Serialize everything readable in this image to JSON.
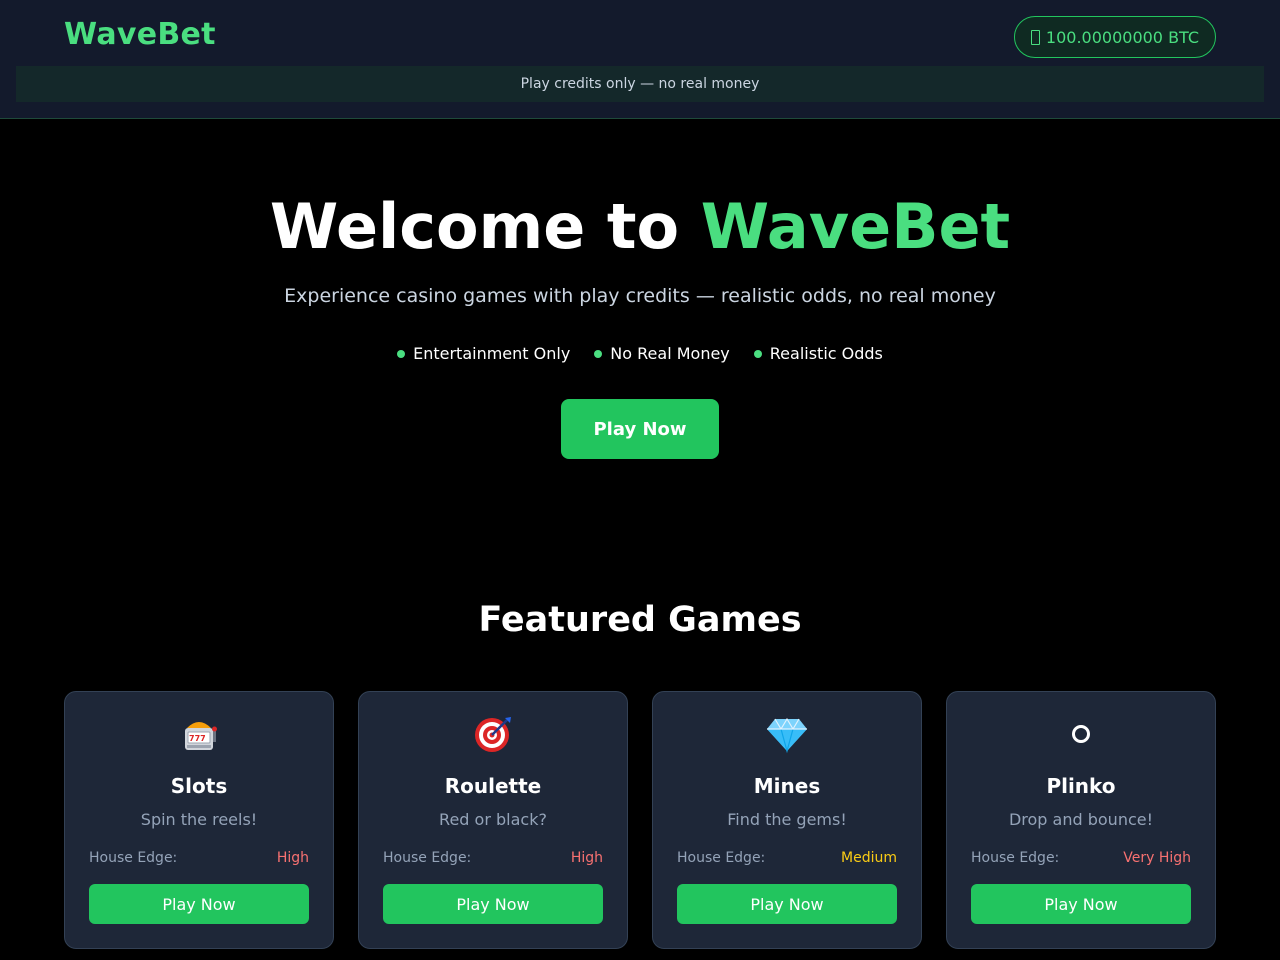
{
  "header": {
    "logo": "WaveBet",
    "balance": "100.00000000 BTC",
    "notice": "Play credits only — no real money"
  },
  "hero": {
    "title_prefix": "Welcome to",
    "title_accent": "WaveBet",
    "subtitle": "Experience casino games with play credits — realistic odds, no real money",
    "features": [
      "Entertainment Only",
      "No Real Money",
      "Realistic Odds"
    ],
    "cta_label": "Play Now"
  },
  "featured": {
    "title": "Featured Games",
    "games": [
      {
        "name": "Slots",
        "description": "Spin the reels!",
        "edge_label": "House Edge:",
        "edge_value": "High",
        "edge_color": "#f87171",
        "icon": "slot-machine-icon",
        "button": "Play Now"
      },
      {
        "name": "Roulette",
        "description": "Red or black?",
        "edge_label": "House Edge:",
        "edge_value": "High",
        "edge_color": "#f87171",
        "icon": "target-icon",
        "button": "Play Now"
      },
      {
        "name": "Mines",
        "description": "Find the gems!",
        "edge_label": "House Edge:",
        "edge_value": "Medium",
        "edge_color": "#facc15",
        "icon": "gem-icon",
        "button": "Play Now"
      },
      {
        "name": "Plinko",
        "description": "Drop and bounce!",
        "edge_label": "House Edge:",
        "edge_value": "Very High",
        "edge_color": "#f87171",
        "icon": "ring-icon",
        "button": "Play Now"
      }
    ]
  },
  "colors": {
    "accent": "#4ade80",
    "button": "#22c55e",
    "card_bg": "#1e2738",
    "header_bg": "#131a2c"
  }
}
